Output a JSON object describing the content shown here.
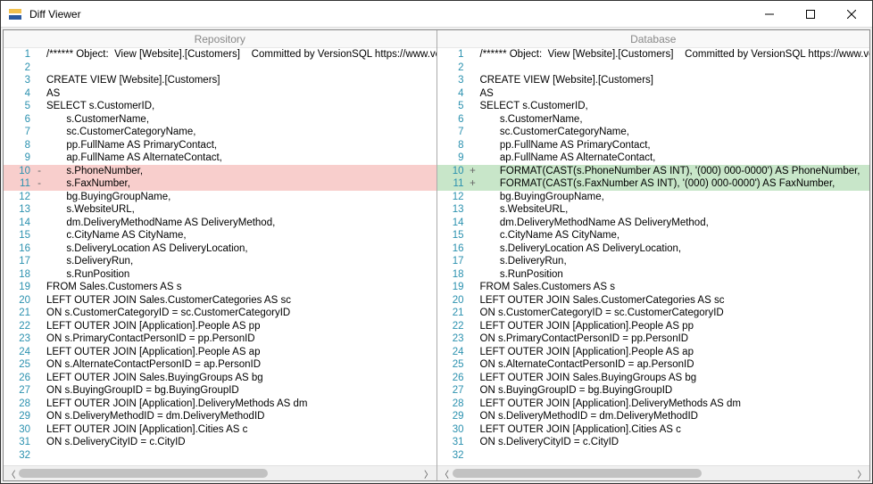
{
  "window": {
    "title": "Diff Viewer"
  },
  "panes": {
    "left": {
      "title": "Repository",
      "lines": [
        {
          "n": 1,
          "m": "",
          "t": "/****** Object:  View [Website].[Customers]    Committed by VersionSQL https://www.versi",
          "c": ""
        },
        {
          "n": 2,
          "m": "",
          "t": "",
          "c": ""
        },
        {
          "n": 3,
          "m": "",
          "t": "CREATE VIEW [Website].[Customers]",
          "c": ""
        },
        {
          "n": 4,
          "m": "",
          "t": "AS",
          "c": ""
        },
        {
          "n": 5,
          "m": "",
          "t": "SELECT s.CustomerID,",
          "c": ""
        },
        {
          "n": 6,
          "m": "",
          "t": "       s.CustomerName,",
          "c": ""
        },
        {
          "n": 7,
          "m": "",
          "t": "       sc.CustomerCategoryName,",
          "c": ""
        },
        {
          "n": 8,
          "m": "",
          "t": "       pp.FullName AS PrimaryContact,",
          "c": ""
        },
        {
          "n": 9,
          "m": "",
          "t": "       ap.FullName AS AlternateContact,",
          "c": ""
        },
        {
          "n": 10,
          "m": "-",
          "t": "       s.PhoneNumber,",
          "c": "removed"
        },
        {
          "n": 11,
          "m": "-",
          "t": "       s.FaxNumber,",
          "c": "removed"
        },
        {
          "n": 12,
          "m": "",
          "t": "       bg.BuyingGroupName,",
          "c": ""
        },
        {
          "n": 13,
          "m": "",
          "t": "       s.WebsiteURL,",
          "c": ""
        },
        {
          "n": 14,
          "m": "",
          "t": "       dm.DeliveryMethodName AS DeliveryMethod,",
          "c": ""
        },
        {
          "n": 15,
          "m": "",
          "t": "       c.CityName AS CityName,",
          "c": ""
        },
        {
          "n": 16,
          "m": "",
          "t": "       s.DeliveryLocation AS DeliveryLocation,",
          "c": ""
        },
        {
          "n": 17,
          "m": "",
          "t": "       s.DeliveryRun,",
          "c": ""
        },
        {
          "n": 18,
          "m": "",
          "t": "       s.RunPosition",
          "c": ""
        },
        {
          "n": 19,
          "m": "",
          "t": "FROM Sales.Customers AS s",
          "c": ""
        },
        {
          "n": 20,
          "m": "",
          "t": "LEFT OUTER JOIN Sales.CustomerCategories AS sc",
          "c": ""
        },
        {
          "n": 21,
          "m": "",
          "t": "ON s.CustomerCategoryID = sc.CustomerCategoryID",
          "c": ""
        },
        {
          "n": 22,
          "m": "",
          "t": "LEFT OUTER JOIN [Application].People AS pp",
          "c": ""
        },
        {
          "n": 23,
          "m": "",
          "t": "ON s.PrimaryContactPersonID = pp.PersonID",
          "c": ""
        },
        {
          "n": 24,
          "m": "",
          "t": "LEFT OUTER JOIN [Application].People AS ap",
          "c": ""
        },
        {
          "n": 25,
          "m": "",
          "t": "ON s.AlternateContactPersonID = ap.PersonID",
          "c": ""
        },
        {
          "n": 26,
          "m": "",
          "t": "LEFT OUTER JOIN Sales.BuyingGroups AS bg",
          "c": ""
        },
        {
          "n": 27,
          "m": "",
          "t": "ON s.BuyingGroupID = bg.BuyingGroupID",
          "c": ""
        },
        {
          "n": 28,
          "m": "",
          "t": "LEFT OUTER JOIN [Application].DeliveryMethods AS dm",
          "c": ""
        },
        {
          "n": 29,
          "m": "",
          "t": "ON s.DeliveryMethodID = dm.DeliveryMethodID",
          "c": ""
        },
        {
          "n": 30,
          "m": "",
          "t": "LEFT OUTER JOIN [Application].Cities AS c",
          "c": ""
        },
        {
          "n": 31,
          "m": "",
          "t": "ON s.DeliveryCityID = c.CityID",
          "c": ""
        },
        {
          "n": 32,
          "m": "",
          "t": "",
          "c": ""
        }
      ]
    },
    "right": {
      "title": "Database",
      "lines": [
        {
          "n": 1,
          "m": "",
          "t": "/****** Object:  View [Website].[Customers]    Committed by VersionSQL https://www.versi",
          "c": ""
        },
        {
          "n": 2,
          "m": "",
          "t": "",
          "c": ""
        },
        {
          "n": 3,
          "m": "",
          "t": "CREATE VIEW [Website].[Customers]",
          "c": ""
        },
        {
          "n": 4,
          "m": "",
          "t": "AS",
          "c": ""
        },
        {
          "n": 5,
          "m": "",
          "t": "SELECT s.CustomerID,",
          "c": ""
        },
        {
          "n": 6,
          "m": "",
          "t": "       s.CustomerName,",
          "c": ""
        },
        {
          "n": 7,
          "m": "",
          "t": "       sc.CustomerCategoryName,",
          "c": ""
        },
        {
          "n": 8,
          "m": "",
          "t": "       pp.FullName AS PrimaryContact,",
          "c": ""
        },
        {
          "n": 9,
          "m": "",
          "t": "       ap.FullName AS AlternateContact,",
          "c": ""
        },
        {
          "n": 10,
          "m": "+",
          "t": "       FORMAT(CAST(s.PhoneNumber AS INT), '(000) 000-0000') AS PhoneNumber,",
          "c": "added"
        },
        {
          "n": 11,
          "m": "+",
          "t": "       FORMAT(CAST(s.FaxNumber AS INT), '(000) 000-0000') AS FaxNumber,",
          "c": "added"
        },
        {
          "n": 12,
          "m": "",
          "t": "       bg.BuyingGroupName,",
          "c": ""
        },
        {
          "n": 13,
          "m": "",
          "t": "       s.WebsiteURL,",
          "c": ""
        },
        {
          "n": 14,
          "m": "",
          "t": "       dm.DeliveryMethodName AS DeliveryMethod,",
          "c": ""
        },
        {
          "n": 15,
          "m": "",
          "t": "       c.CityName AS CityName,",
          "c": ""
        },
        {
          "n": 16,
          "m": "",
          "t": "       s.DeliveryLocation AS DeliveryLocation,",
          "c": ""
        },
        {
          "n": 17,
          "m": "",
          "t": "       s.DeliveryRun,",
          "c": ""
        },
        {
          "n": 18,
          "m": "",
          "t": "       s.RunPosition",
          "c": ""
        },
        {
          "n": 19,
          "m": "",
          "t": "FROM Sales.Customers AS s",
          "c": ""
        },
        {
          "n": 20,
          "m": "",
          "t": "LEFT OUTER JOIN Sales.CustomerCategories AS sc",
          "c": ""
        },
        {
          "n": 21,
          "m": "",
          "t": "ON s.CustomerCategoryID = sc.CustomerCategoryID",
          "c": ""
        },
        {
          "n": 22,
          "m": "",
          "t": "LEFT OUTER JOIN [Application].People AS pp",
          "c": ""
        },
        {
          "n": 23,
          "m": "",
          "t": "ON s.PrimaryContactPersonID = pp.PersonID",
          "c": ""
        },
        {
          "n": 24,
          "m": "",
          "t": "LEFT OUTER JOIN [Application].People AS ap",
          "c": ""
        },
        {
          "n": 25,
          "m": "",
          "t": "ON s.AlternateContactPersonID = ap.PersonID",
          "c": ""
        },
        {
          "n": 26,
          "m": "",
          "t": "LEFT OUTER JOIN Sales.BuyingGroups AS bg",
          "c": ""
        },
        {
          "n": 27,
          "m": "",
          "t": "ON s.BuyingGroupID = bg.BuyingGroupID",
          "c": ""
        },
        {
          "n": 28,
          "m": "",
          "t": "LEFT OUTER JOIN [Application].DeliveryMethods AS dm",
          "c": ""
        },
        {
          "n": 29,
          "m": "",
          "t": "ON s.DeliveryMethodID = dm.DeliveryMethodID",
          "c": ""
        },
        {
          "n": 30,
          "m": "",
          "t": "LEFT OUTER JOIN [Application].Cities AS c",
          "c": ""
        },
        {
          "n": 31,
          "m": "",
          "t": "ON s.DeliveryCityID = c.CityID",
          "c": ""
        },
        {
          "n": 32,
          "m": "",
          "t": "",
          "c": ""
        }
      ]
    }
  }
}
